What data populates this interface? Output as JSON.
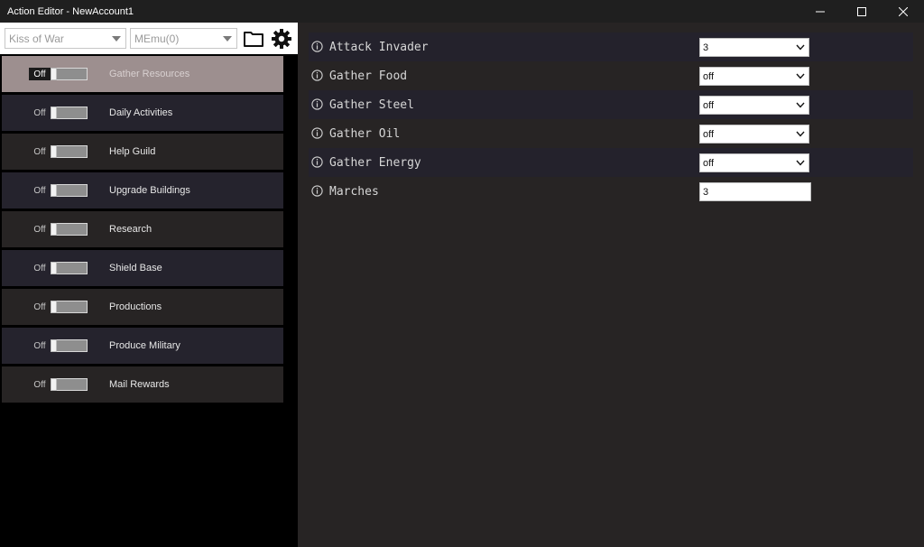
{
  "window": {
    "title": "Action Editor - NewAccount1",
    "minimize_icon": "minimize-icon",
    "maximize_icon": "maximize-icon",
    "close_icon": "close-icon"
  },
  "toolbar": {
    "game_select": "Kiss of War",
    "emulator_select": "MEmu(0)",
    "folder_icon": "folder-icon",
    "settings_icon": "gear-icon"
  },
  "actions": [
    {
      "state": "Off",
      "name": "Gather Resources",
      "selected": true
    },
    {
      "state": "Off",
      "name": "Daily Activities",
      "selected": false
    },
    {
      "state": "Off",
      "name": "Help Guild",
      "selected": false
    },
    {
      "state": "Off",
      "name": "Upgrade Buildings",
      "selected": false
    },
    {
      "state": "Off",
      "name": "Research",
      "selected": false
    },
    {
      "state": "Off",
      "name": "Shield Base",
      "selected": false
    },
    {
      "state": "Off",
      "name": "Productions",
      "selected": false
    },
    {
      "state": "Off",
      "name": "Produce Military",
      "selected": false
    },
    {
      "state": "Off",
      "name": "Mail Rewards",
      "selected": false
    }
  ],
  "settings": [
    {
      "label": "Attack Invader",
      "control": "select",
      "value": "3"
    },
    {
      "label": "Gather Food",
      "control": "select",
      "value": "off"
    },
    {
      "label": "Gather Steel",
      "control": "select",
      "value": "off"
    },
    {
      "label": "Gather Oil",
      "control": "select",
      "value": "off"
    },
    {
      "label": "Gather Energy",
      "control": "select",
      "value": "off"
    },
    {
      "label": "Marches",
      "control": "text",
      "value": "3"
    }
  ]
}
